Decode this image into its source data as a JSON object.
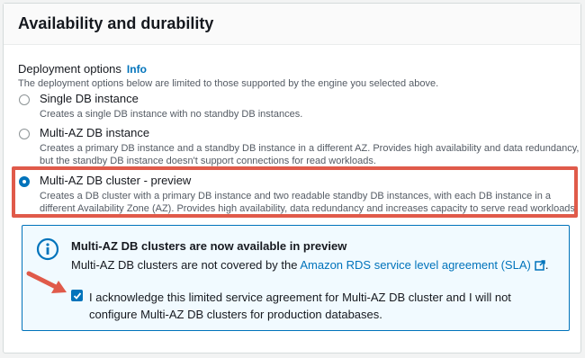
{
  "section": {
    "title": "Availability and durability"
  },
  "deployment": {
    "label": "Deployment options",
    "info_link": "Info",
    "description": "The deployment options below are limited to those supported by the engine you selected above.",
    "options": [
      {
        "title": "Single DB instance",
        "description": "Creates a single DB instance with no standby DB instances.",
        "selected": false
      },
      {
        "title": "Multi-AZ DB instance",
        "description": "Creates a primary DB instance and a standby DB instance in a different AZ. Provides high availability and data redundancy, but the standby DB instance doesn't support connections for read workloads.",
        "selected": false
      },
      {
        "title": "Multi-AZ DB cluster - preview",
        "description": "Creates a DB cluster with a primary DB instance and two readable standby DB instances, with each DB instance in a different Availability Zone (AZ). Provides high availability, data redundancy and increases capacity to serve read workloads.",
        "selected": true
      }
    ]
  },
  "notice": {
    "title": "Multi-AZ DB clusters are now available in preview",
    "text_before_link": "Multi-AZ DB clusters are not covered by the",
    "link": "Amazon RDS service level agreement (SLA)",
    "text_after_link": ".",
    "acknowledgement": "I acknowledge this limited service agreement for Multi-AZ DB cluster and I will not configure Multi-AZ DB clusters for production databases.",
    "acknowledged": true
  },
  "colors": {
    "accent": "#0073bb",
    "highlight": "#e05a4a",
    "info_bg": "#f1faff"
  }
}
